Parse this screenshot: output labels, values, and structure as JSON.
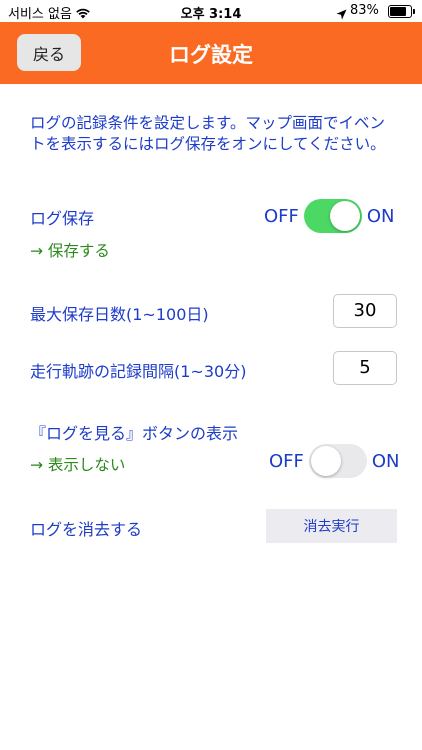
{
  "status_bar": {
    "carrier": "서비스 없음",
    "time": "오후 3:14",
    "battery": "83%",
    "battery_level": 0.83,
    "icons": [
      "wifi-icon",
      "location-arrow-icon",
      "battery-icon"
    ]
  },
  "navbar": {
    "back_label": "戻る",
    "title": "ログ設定",
    "bg_color": "#fb6a22"
  },
  "description": "ログの記録条件を設定します。マップ画面でイベントを表示するにはログ保存をオンにしてください。",
  "log_save": {
    "label": "ログ保存",
    "off_label": "OFF",
    "on_label": "ON",
    "enabled": true,
    "status": "→ 保存する"
  },
  "max_days": {
    "label": "最大保存日数(1~100日)",
    "value": "30"
  },
  "track_interval": {
    "label": "走行軌跡の記録間隔(1~30分)",
    "value": "5"
  },
  "show_log_button": {
    "label": "『ログを見る』ボタンの表示",
    "off_label": "OFF",
    "on_label": "ON",
    "enabled": false,
    "status": "→ 表示しない"
  },
  "delete_log": {
    "label": "ログを消去する",
    "button_label": "消去実行"
  },
  "colors": {
    "accent": "#fb6a22",
    "label_blue": "#1d3cc9",
    "status_green": "#2a8a1a",
    "switch_on": "#4cd864"
  }
}
